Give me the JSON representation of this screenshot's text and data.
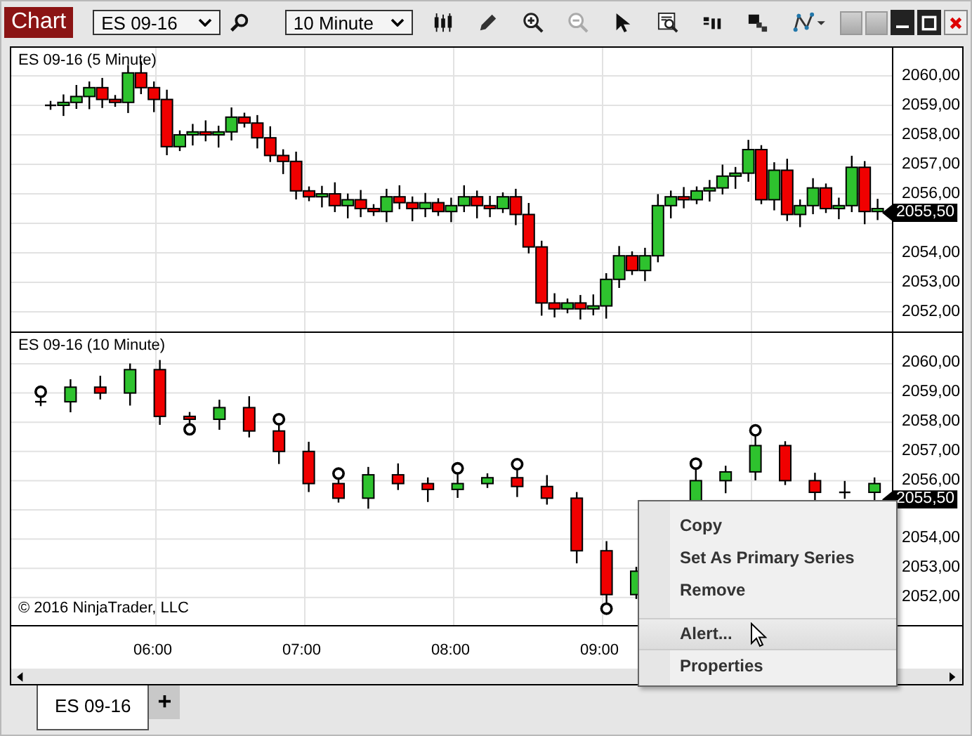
{
  "window": {
    "title": "Chart"
  },
  "toolbar": {
    "instrument": "ES 09-16",
    "interval": "10 Minute",
    "zoom_out": {
      "disabled": true
    }
  },
  "panels": [
    {
      "title": "ES 09-16 (5 Minute)",
      "price_axis": [
        {
          "kind": "tick",
          "text": "2060,00"
        },
        {
          "kind": "tick",
          "text": "2059,00"
        },
        {
          "kind": "tick",
          "text": "2058,00"
        },
        {
          "kind": "tick",
          "text": "2057,00"
        },
        {
          "kind": "tick",
          "text": "2056,00"
        },
        {
          "kind": "marker",
          "text": "2055,50"
        },
        {
          "kind": "tick",
          "text": "2054,00"
        },
        {
          "kind": "tick",
          "text": "2053,00"
        },
        {
          "kind": "tick",
          "text": "2052,00"
        }
      ]
    },
    {
      "title": "ES 09-16 (10 Minute)",
      "footnote": "© 2016 NinjaTrader, LLC",
      "price_axis": [
        {
          "kind": "tick",
          "text": "2060,00"
        },
        {
          "kind": "tick",
          "text": "2059,00"
        },
        {
          "kind": "tick",
          "text": "2058,00"
        },
        {
          "kind": "tick",
          "text": "2057,00"
        },
        {
          "kind": "tick",
          "text": "2056,00"
        },
        {
          "kind": "marker",
          "text": "2055,50"
        },
        {
          "kind": "tick",
          "text": "2054,00"
        },
        {
          "kind": "tick",
          "text": "2053,00"
        },
        {
          "kind": "tick",
          "text": "2052,00"
        }
      ]
    }
  ],
  "time_axis": [
    "06:00",
    "07:00",
    "08:00",
    "09:00"
  ],
  "context_menu": {
    "items": [
      {
        "kind": "item",
        "label": "Copy",
        "selected": false
      },
      {
        "kind": "item",
        "label": "Set As Primary Series",
        "selected": false
      },
      {
        "kind": "item",
        "label": "Remove",
        "selected": false
      },
      {
        "kind": "separator"
      },
      {
        "kind": "item",
        "label": "Alert...",
        "selected": true
      },
      {
        "kind": "item",
        "label": "Properties",
        "selected": false
      }
    ]
  },
  "tabs": [
    {
      "label": "ES 09-16",
      "selected": true
    }
  ],
  "add_tab": "+"
}
